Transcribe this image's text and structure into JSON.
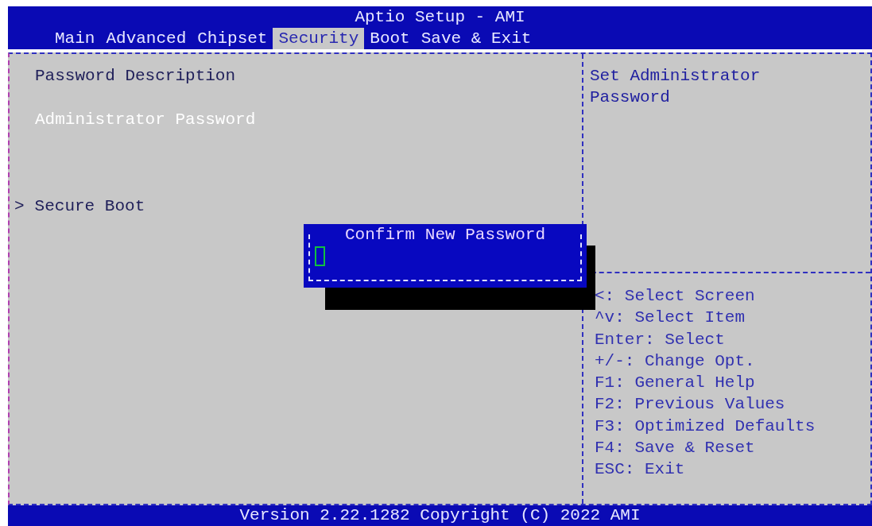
{
  "window": {
    "title": "Aptio Setup - AMI"
  },
  "tabs": [
    {
      "label": "Main",
      "selected": false
    },
    {
      "label": "Advanced",
      "selected": false
    },
    {
      "label": "Chipset",
      "selected": false
    },
    {
      "label": "Security",
      "selected": true
    },
    {
      "label": "Boot",
      "selected": false
    },
    {
      "label": "Save & Exit",
      "selected": false
    }
  ],
  "items": [
    {
      "kind": "heading",
      "label": "Password Description",
      "selected": false
    },
    {
      "kind": "item",
      "label": "Administrator Password",
      "selected": true
    },
    {
      "kind": "submenu",
      "marker": ">",
      "label": "Secure Boot",
      "selected": false
    }
  ],
  "help_text": "Set Administrator Password",
  "key_help": [
    "<: Select Screen",
    "^v: Select Item",
    "Enter: Select",
    "+/-: Change Opt.",
    "F1: General Help",
    "F2: Previous Values",
    "F3: Optimized Defaults",
    "F4: Save & Reset",
    "ESC: Exit"
  ],
  "dialog": {
    "title": "Confirm New Password"
  },
  "status_bar": "Version 2.22.1282 Copyright (C) 2022 AMI"
}
